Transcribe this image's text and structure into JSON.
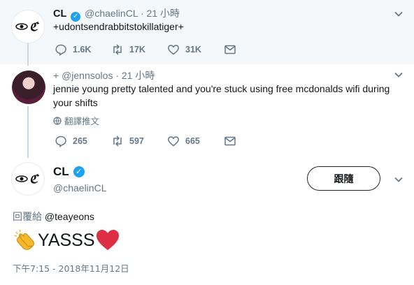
{
  "top_tweet": {
    "name": "CL",
    "handle": "@chaelinCL",
    "time": "· 21 小時",
    "text": "+udontsendrabbitstokillatiger+",
    "replies": "1.6K",
    "retweets": "17K",
    "likes": "31K"
  },
  "reply_tweet": {
    "prefix": "+",
    "handle": "@jennsolos",
    "time": "· 21 小時",
    "text": "jennie young pretty talented and you're stuck using free mcdonalds wifi during your shifts",
    "translate_label": "翻譯推文",
    "replies": "265",
    "retweets": "597",
    "likes": "665"
  },
  "main_tweet": {
    "name": "CL",
    "handle": "@chaelinCL",
    "follow_label": "跟隨",
    "reply_prefix": "回覆給",
    "reply_handle": "@teayeons",
    "text": "YASSS",
    "timestamp": "下午7:15 - 2018年11月12日"
  },
  "icons": {
    "reply": "reply-icon",
    "retweet": "retweet-icon",
    "like": "heart-icon",
    "dm": "envelope-icon",
    "more": "chevron-down-icon",
    "verified": "verified-badge-icon",
    "clap": "clapping-hands-emoji",
    "heart_emoji": "red-heart-emoji"
  },
  "colors": {
    "verified": "#1da1f2",
    "secondary_text": "#657786",
    "heart_emoji": "#dd2e44",
    "clap": "#f4b82a"
  }
}
